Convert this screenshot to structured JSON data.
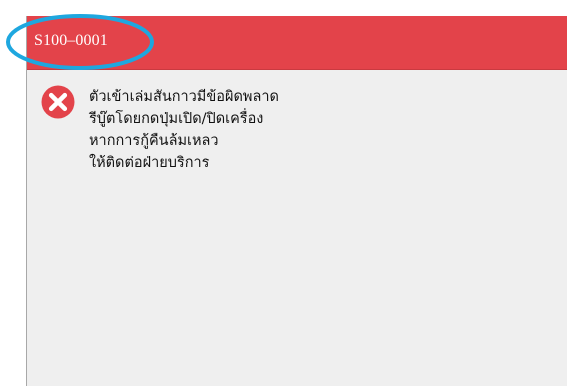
{
  "dialog": {
    "title": "S100–0001",
    "icon": "error-icon",
    "message_lines": [
      "ตัวเข้าเล่มสันกาวมีข้อผิดพลาด",
      "รีบู๊ตโดยกดปุ่มเปิด/ปิดเครื่อง",
      "หากการกู้คืนล้มเหลว",
      "ให้ติดต่อฝ่ายบริการ"
    ]
  },
  "colors": {
    "title_bar": "#e3434a",
    "highlight": "#1ea7df",
    "dialog_bg": "#efefef",
    "error_icon": "#e3434a"
  }
}
